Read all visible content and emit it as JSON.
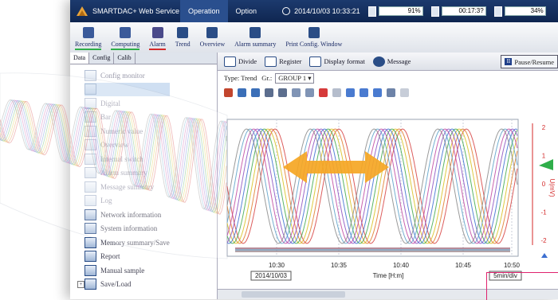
{
  "topbar": {
    "brand": "SMARTDAC+ Web Service",
    "menus": [
      "Operation",
      "Option"
    ],
    "datetime": "2014/10/03 10:33:21",
    "meters": [
      "91%",
      "00:17:3?",
      "34%"
    ]
  },
  "toolbar": [
    {
      "label": "Recording",
      "bar": "#2fae4a"
    },
    {
      "label": "Computing",
      "bar": "#2fae4a"
    },
    {
      "label": "Alarm",
      "bar": "#d42a2a"
    },
    {
      "label": "Trend",
      "bar": ""
    },
    {
      "label": "Overview",
      "bar": ""
    },
    {
      "label": "Alarm summary",
      "bar": ""
    },
    {
      "label": "Print Config. Window",
      "bar": ""
    }
  ],
  "left_tabs": [
    "Data",
    "Config",
    "Calib"
  ],
  "tree": [
    {
      "label": "Config monitor",
      "faded": true
    },
    {
      "label": "",
      "faded": true,
      "sel": true
    },
    {
      "label": "Digital",
      "faded": true
    },
    {
      "label": "Bar",
      "faded": true
    },
    {
      "label": "Numeric value",
      "faded": true
    },
    {
      "label": "Overview",
      "faded": true
    },
    {
      "label": "Internal switch",
      "faded": true
    },
    {
      "label": "Alarm summary",
      "faded": true
    },
    {
      "label": "Message summary",
      "faded": true
    },
    {
      "label": "Log",
      "faded": true
    },
    {
      "label": "Network information",
      "faded": false
    },
    {
      "label": "System information",
      "faded": false
    },
    {
      "label": "Memory summary/Save",
      "faded": false
    },
    {
      "label": "Report",
      "faded": false
    },
    {
      "label": "Manual sample",
      "faded": false
    },
    {
      "label": "Save/Load",
      "faded": false
    }
  ],
  "right_toolbar": {
    "divide": "Divide",
    "register": "Register",
    "display_format": "Display format",
    "message": "Message",
    "pause_resume": "Pause/Resume"
  },
  "type_row": {
    "type_label": "Type: Trend",
    "group_label": "Gr.:",
    "group_value": "GROUP 1"
  },
  "colors": {
    "accent": "#1c3a6e",
    "arrow": "#f5a623",
    "scale": "#d42a2a",
    "highlight": "#e0226e"
  },
  "chart_data": {
    "type": "line",
    "x_ticks": [
      "10:30",
      "10:35",
      "10:40",
      "10:45",
      "10:50"
    ],
    "xlabel": "Time [H:m]",
    "date_label": "2014/10/03",
    "div_label": "5min/div",
    "y_ticks": [
      "2",
      "1",
      "0",
      "-1",
      "-2"
    ],
    "ylabel": "U(mV)",
    "ylim": [
      -2,
      2
    ],
    "series_colors": [
      "#d64040",
      "#e07b2a",
      "#d8c020",
      "#3fa84a",
      "#3c6fd0",
      "#8a4fc0",
      "#c048a0",
      "#5aa0c8",
      "#888888"
    ]
  }
}
